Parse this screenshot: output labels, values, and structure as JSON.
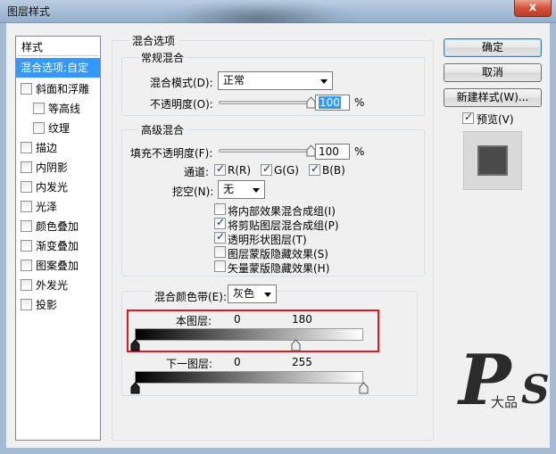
{
  "window": {
    "title": "图层样式",
    "close_glyph": "x"
  },
  "style_list": {
    "header": "样式",
    "items": [
      {
        "label": "混合选项:自定",
        "selected": true,
        "checkbox": false
      },
      {
        "label": "斜面和浮雕",
        "checked": false
      },
      {
        "label": "等高线",
        "checked": false
      },
      {
        "label": "纹理",
        "checked": false
      },
      {
        "label": "描边",
        "checked": false
      },
      {
        "label": "内阴影",
        "checked": false
      },
      {
        "label": "内发光",
        "checked": false
      },
      {
        "label": "光泽",
        "checked": false
      },
      {
        "label": "颜色叠加",
        "checked": false
      },
      {
        "label": "渐变叠加",
        "checked": false
      },
      {
        "label": "图案叠加",
        "checked": false
      },
      {
        "label": "外发光",
        "checked": false
      },
      {
        "label": "投影",
        "checked": false
      }
    ]
  },
  "blend_options": {
    "title": "混合选项",
    "general": {
      "title": "常规混合",
      "mode_label": "混合模式(D):",
      "mode_value": "正常",
      "opacity_label": "不透明度(O):",
      "opacity_value": "100",
      "opacity_unit": "%",
      "opacity_level": 1.0
    },
    "advanced": {
      "title": "高级混合",
      "fill_label": "填充不透明度(F):",
      "fill_value": "100",
      "fill_unit": "%",
      "fill_level": 1.0,
      "channels_label": "通道:",
      "channels": [
        {
          "label": "R(R)",
          "checked": true
        },
        {
          "label": "G(G)",
          "checked": true
        },
        {
          "label": "B(B)",
          "checked": true
        }
      ],
      "knockout_label": "挖空(N):",
      "knockout_value": "无",
      "options": [
        {
          "label": "将内部效果混合成组(I)",
          "checked": false
        },
        {
          "label": "将剪贴图层混合成组(P)",
          "checked": true
        },
        {
          "label": "透明形状图层(T)",
          "checked": true
        },
        {
          "label": "图层蒙版隐藏效果(S)",
          "checked": false
        },
        {
          "label": "矢量蒙版隐藏效果(H)",
          "checked": false
        }
      ]
    },
    "blend_if": {
      "label": "混合颜色带(E):",
      "value": "灰色",
      "this_layer": {
        "label": "本图层:",
        "low": "0",
        "high": "180",
        "low_value": 0,
        "high_value": 180,
        "max": 255
      },
      "underlying": {
        "label": "下一图层:",
        "low": "0",
        "high": "255",
        "low_value": 0,
        "high_value": 255,
        "max": 255
      }
    }
  },
  "buttons": {
    "ok": "确定",
    "cancel": "取消",
    "new_style": "新建样式(W)...",
    "preview_label": "预览(V)",
    "preview_checked": true
  },
  "watermark": {
    "big": "P",
    "small": "大品",
    "tail": "S"
  },
  "colors": {
    "selection": "#3399ff",
    "highlight_box": "#e0191a",
    "preview_swatch": "#4b4b4b"
  }
}
